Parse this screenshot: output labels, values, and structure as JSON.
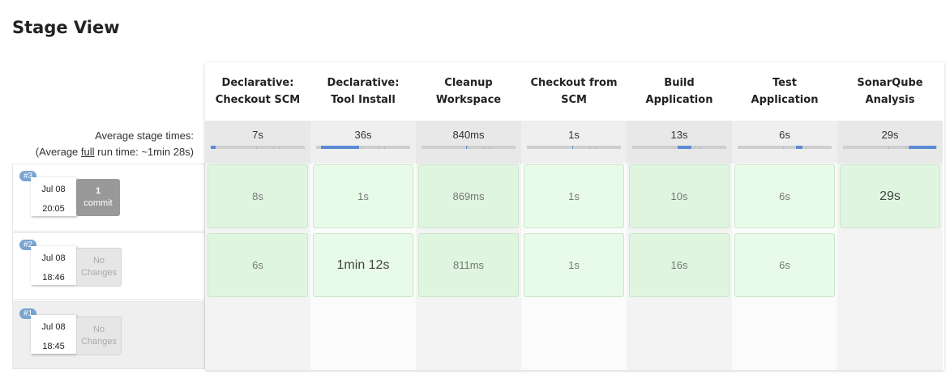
{
  "title": "Stage View",
  "average": {
    "label": "Average stage times:",
    "run_prefix": "(Average ",
    "run_link": "full",
    "run_suffix": " run time: ~1min 28s)"
  },
  "stages": [
    {
      "line1": "Declarative:",
      "line2": "Checkout SCM",
      "avg": "7s",
      "avg_fraction": 0.05
    },
    {
      "line1": "Declarative:",
      "line2": "Tool Install",
      "avg": "36s",
      "avg_fraction": 0.41
    },
    {
      "line1": "Cleanup",
      "line2": "Workspace",
      "avg": "840ms",
      "avg_fraction": 0.01
    },
    {
      "line1": "Checkout from",
      "line2": "SCM",
      "avg": "1s",
      "avg_fraction": 0.01
    },
    {
      "line1": "Build",
      "line2": "Application",
      "avg": "13s",
      "avg_fraction": 0.15
    },
    {
      "line1": "Test",
      "line2": "Application",
      "avg": "6s",
      "avg_fraction": 0.07
    },
    {
      "line1": "SonarQube",
      "line2": "Analysis",
      "avg": "29s",
      "avg_fraction": 0.29
    }
  ],
  "runs": [
    {
      "id": "#3",
      "date": "Jul 08",
      "time": "20:05",
      "changes": {
        "type": "commit",
        "line1": "1",
        "line2": "commit"
      },
      "cells": [
        "8s",
        "1s",
        "869ms",
        "1s",
        "10s",
        "6s",
        "29s"
      ]
    },
    {
      "id": "#2",
      "date": "Jul 08",
      "time": "18:46",
      "changes": {
        "type": "none",
        "line1": "No",
        "line2": "Changes"
      },
      "cells": [
        "6s",
        "1min 12s",
        "811ms",
        "1s",
        "16s",
        "6s",
        ""
      ]
    },
    {
      "id": "#1",
      "date": "Jul 08",
      "time": "18:45",
      "changes": {
        "type": "none",
        "line1": "No",
        "line2": "Changes"
      },
      "cells": [
        "",
        "",
        "",
        "",
        "",
        "",
        ""
      ]
    }
  ],
  "colors": {
    "success_dark": "#dff5df",
    "success_light": "#e8fae8",
    "progress": "#5b8bd4",
    "badge": "#7aa4d1"
  }
}
